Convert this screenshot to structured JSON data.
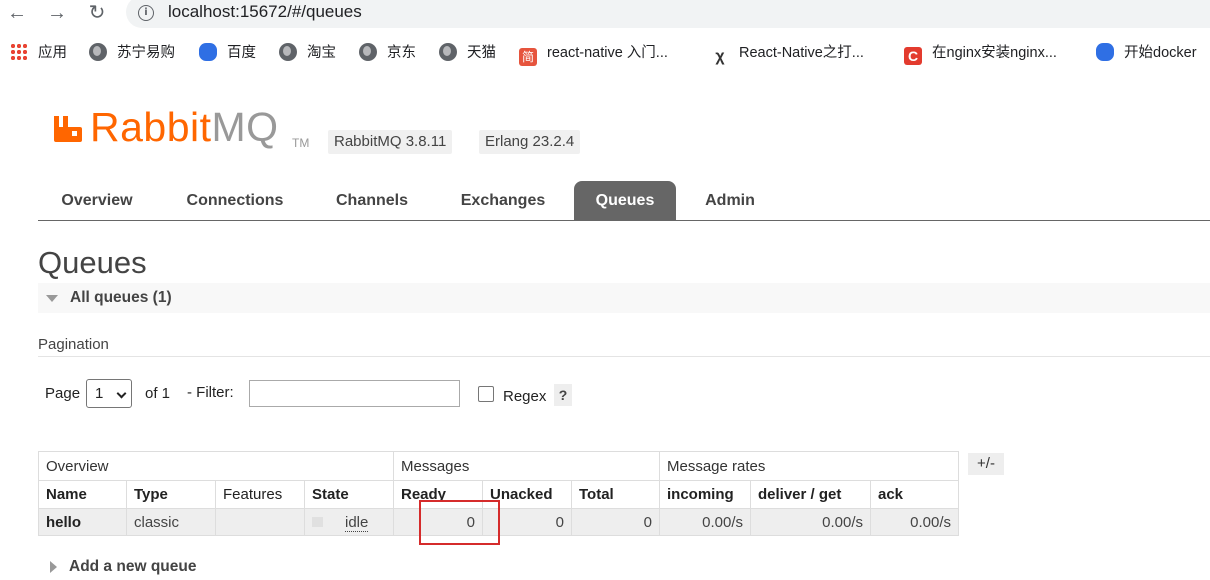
{
  "browser": {
    "url": "localhost:15672/#/queues",
    "bookmarks": [
      {
        "label": "应用",
        "icon": "apps-grid-icon"
      },
      {
        "label": "苏宁易购",
        "icon": "globe-icon"
      },
      {
        "label": "百度",
        "icon": "baidu-paw-icon"
      },
      {
        "label": "淘宝",
        "icon": "globe-icon"
      },
      {
        "label": "京东",
        "icon": "globe-icon"
      },
      {
        "label": "天猫",
        "icon": "globe-icon"
      },
      {
        "label": "react-native 入门...",
        "icon": "jianshu-icon"
      },
      {
        "label": "React-Native之打...",
        "icon": "rn-icon"
      },
      {
        "label": "在nginx安装nginx...",
        "icon": "csdn-icon"
      },
      {
        "label": "开始docker",
        "icon": "baidu-paw-icon"
      }
    ]
  },
  "header": {
    "logo_rabbit": "Rabbit",
    "logo_mq": "MQ",
    "logo_tm": "TM",
    "rabbitmq_version": "RabbitMQ 3.8.11",
    "erlang_version": "Erlang 23.2.4",
    "brand_color": "#ff6600"
  },
  "tabs": [
    {
      "label": "Overview",
      "active": false
    },
    {
      "label": "Connections",
      "active": false
    },
    {
      "label": "Channels",
      "active": false
    },
    {
      "label": "Exchanges",
      "active": false
    },
    {
      "label": "Queues",
      "active": true
    },
    {
      "label": "Admin",
      "active": false
    }
  ],
  "page": {
    "title": "Queues",
    "section_label": "All queues (1)",
    "pagination_label": "Pagination",
    "page_label": "Page",
    "page_value": "1",
    "of_label": "of 1",
    "filter_label": "- Filter:",
    "filter_value": "",
    "regex_label": "Regex",
    "help_label": "?",
    "plus_minus": "+/-",
    "add_queue_label": "Add a new queue"
  },
  "table": {
    "groups": [
      "Overview",
      "Messages",
      "Message rates"
    ],
    "columns": [
      "Name",
      "Type",
      "Features",
      "State",
      "Ready",
      "Unacked",
      "Total",
      "incoming",
      "deliver / get",
      "ack"
    ],
    "rows": [
      {
        "name": "hello",
        "type": "classic",
        "features": "",
        "state": "idle",
        "ready": "0",
        "unacked": "0",
        "total": "0",
        "incoming": "0.00/s",
        "deliver_get": "0.00/s",
        "ack": "0.00/s"
      }
    ]
  },
  "highlight_color": "#d52b2b"
}
